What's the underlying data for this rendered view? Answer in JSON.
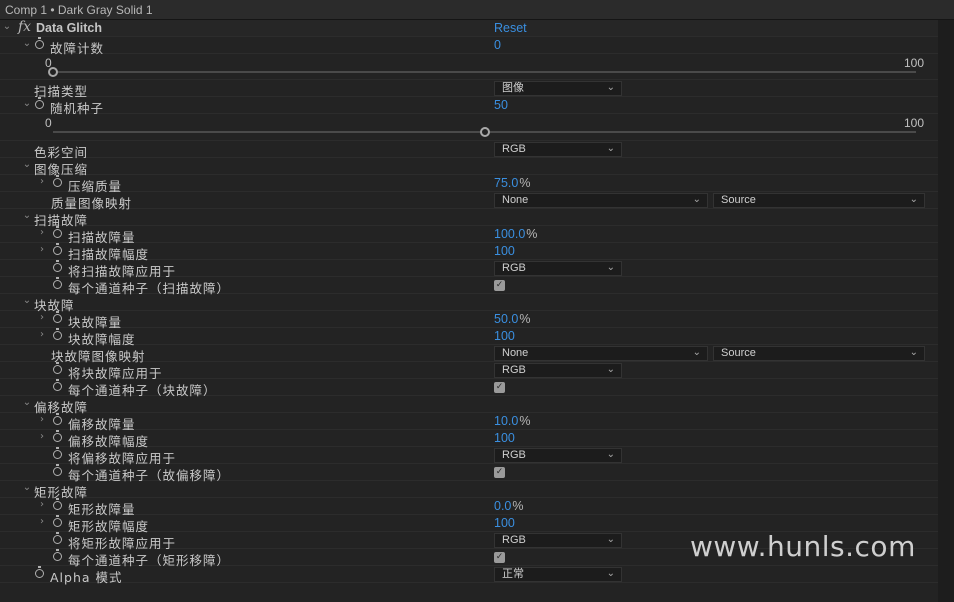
{
  "header": {
    "title": "Comp 1 • Dark Gray Solid 1"
  },
  "effect": {
    "icon": "fx",
    "name": "Data Glitch",
    "reset_label": "Reset"
  },
  "rows": [
    {
      "label": "故障计数",
      "level": 1,
      "twirl": "down",
      "stopwatch": true,
      "type": "value",
      "value": "0"
    },
    {
      "type": "slider",
      "min": "0",
      "max": "100",
      "fraction": 0
    },
    {
      "label": "扫描类型",
      "level": 1,
      "twirl": "none",
      "stopwatch": false,
      "type": "dropdown",
      "value": "图像"
    },
    {
      "label": "随机种子",
      "level": 1,
      "twirl": "down",
      "stopwatch": true,
      "type": "value",
      "value": "50"
    },
    {
      "type": "slider",
      "min": "0",
      "max": "100",
      "fraction": 0.5
    },
    {
      "label": "色彩空间",
      "level": 1,
      "twirl": "none",
      "stopwatch": false,
      "type": "dropdown",
      "value": "RGB"
    },
    {
      "label": "图像压缩",
      "level": 1,
      "twirl": "down",
      "stopwatch": false,
      "type": "group"
    },
    {
      "label": "压缩质量",
      "level": 2,
      "twirl": "right",
      "stopwatch": true,
      "type": "value",
      "value": "75.0",
      "unit": "%"
    },
    {
      "label": "质量图像映射",
      "level": 2,
      "twirl": "none",
      "stopwatch": false,
      "type": "dual",
      "value": "None",
      "value2": "Source"
    },
    {
      "label": "扫描故障",
      "level": 1,
      "twirl": "down",
      "stopwatch": false,
      "type": "group"
    },
    {
      "label": "扫描故障量",
      "level": 2,
      "twirl": "right",
      "stopwatch": true,
      "type": "value",
      "value": "100.0",
      "unit": "%"
    },
    {
      "label": "扫描故障幅度",
      "level": 2,
      "twirl": "right",
      "stopwatch": true,
      "type": "value",
      "value": "100"
    },
    {
      "label": "将扫描故障应用于",
      "level": 2,
      "twirl": "none",
      "stopwatch": true,
      "type": "dropdown",
      "value": "RGB"
    },
    {
      "label": "每个通道种子（扫描故障）",
      "level": 2,
      "twirl": "none",
      "stopwatch": true,
      "type": "checkbox",
      "checked": true
    },
    {
      "label": "块故障",
      "level": 1,
      "twirl": "down",
      "stopwatch": false,
      "type": "group"
    },
    {
      "label": "块故障量",
      "level": 2,
      "twirl": "right",
      "stopwatch": true,
      "type": "value",
      "value": "50.0",
      "unit": "%"
    },
    {
      "label": "块故障幅度",
      "level": 2,
      "twirl": "right",
      "stopwatch": true,
      "type": "value",
      "value": "100"
    },
    {
      "label": "块故障图像映射",
      "level": 2,
      "twirl": "none",
      "stopwatch": false,
      "type": "dual",
      "value": "None",
      "value2": "Source"
    },
    {
      "label": "将块故障应用于",
      "level": 2,
      "twirl": "none",
      "stopwatch": true,
      "type": "dropdown",
      "value": "RGB"
    },
    {
      "label": "每个通道种子（块故障）",
      "level": 2,
      "twirl": "none",
      "stopwatch": true,
      "type": "checkbox",
      "checked": true
    },
    {
      "label": "偏移故障",
      "level": 1,
      "twirl": "down",
      "stopwatch": false,
      "type": "group"
    },
    {
      "label": "偏移故障量",
      "level": 2,
      "twirl": "right",
      "stopwatch": true,
      "type": "value",
      "value": "10.0",
      "unit": "%"
    },
    {
      "label": "偏移故障幅度",
      "level": 2,
      "twirl": "right",
      "stopwatch": true,
      "type": "value",
      "value": "100"
    },
    {
      "label": "将偏移故障应用于",
      "level": 2,
      "twirl": "none",
      "stopwatch": true,
      "type": "dropdown",
      "value": "RGB"
    },
    {
      "label": "每个通道种子（故偏移障）",
      "level": 2,
      "twirl": "none",
      "stopwatch": true,
      "type": "checkbox",
      "checked": true
    },
    {
      "label": "矩形故障",
      "level": 1,
      "twirl": "down",
      "stopwatch": false,
      "type": "group"
    },
    {
      "label": "矩形故障量",
      "level": 2,
      "twirl": "right",
      "stopwatch": true,
      "type": "value",
      "value": "0.0",
      "unit": "%"
    },
    {
      "label": "矩形故障幅度",
      "level": 2,
      "twirl": "right",
      "stopwatch": true,
      "type": "value",
      "value": "100"
    },
    {
      "label": "将矩形故障应用于",
      "level": 2,
      "twirl": "none",
      "stopwatch": true,
      "type": "dropdown",
      "value": "RGB"
    },
    {
      "label": "每个通道种子（矩形移障）",
      "level": 2,
      "twirl": "none",
      "stopwatch": true,
      "type": "checkbox",
      "checked": true
    },
    {
      "label": "Alpha 模式",
      "level": 1,
      "twirl": "none",
      "stopwatch": true,
      "type": "dropdown",
      "value": "正常"
    }
  ],
  "watermark": "www.hunls.com",
  "colors": {
    "accent": "#3a8fe0",
    "background": "#232323"
  }
}
